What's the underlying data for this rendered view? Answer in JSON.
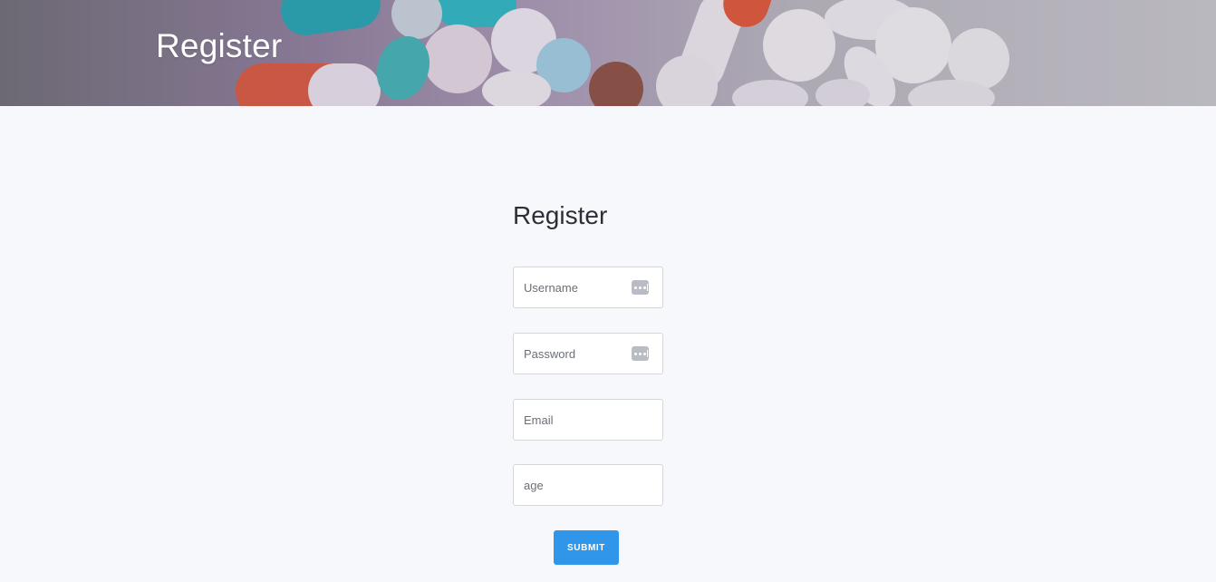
{
  "header": {
    "title": "Register"
  },
  "form": {
    "title": "Register",
    "fields": [
      {
        "placeholder": "Username",
        "value": "",
        "has_password_manager_icon": true
      },
      {
        "placeholder": "Password",
        "value": "",
        "has_password_manager_icon": true
      },
      {
        "placeholder": "Email",
        "value": ""
      },
      {
        "placeholder": "age",
        "value": ""
      }
    ],
    "submit_label": "SUBMIT"
  },
  "colors": {
    "page_background": "#f7f8fb",
    "accent": "#2f96ea",
    "field_border": "#d4d6db",
    "icon": "#b9bcc4"
  },
  "icons": {
    "password_manager": "password-dots-icon"
  }
}
